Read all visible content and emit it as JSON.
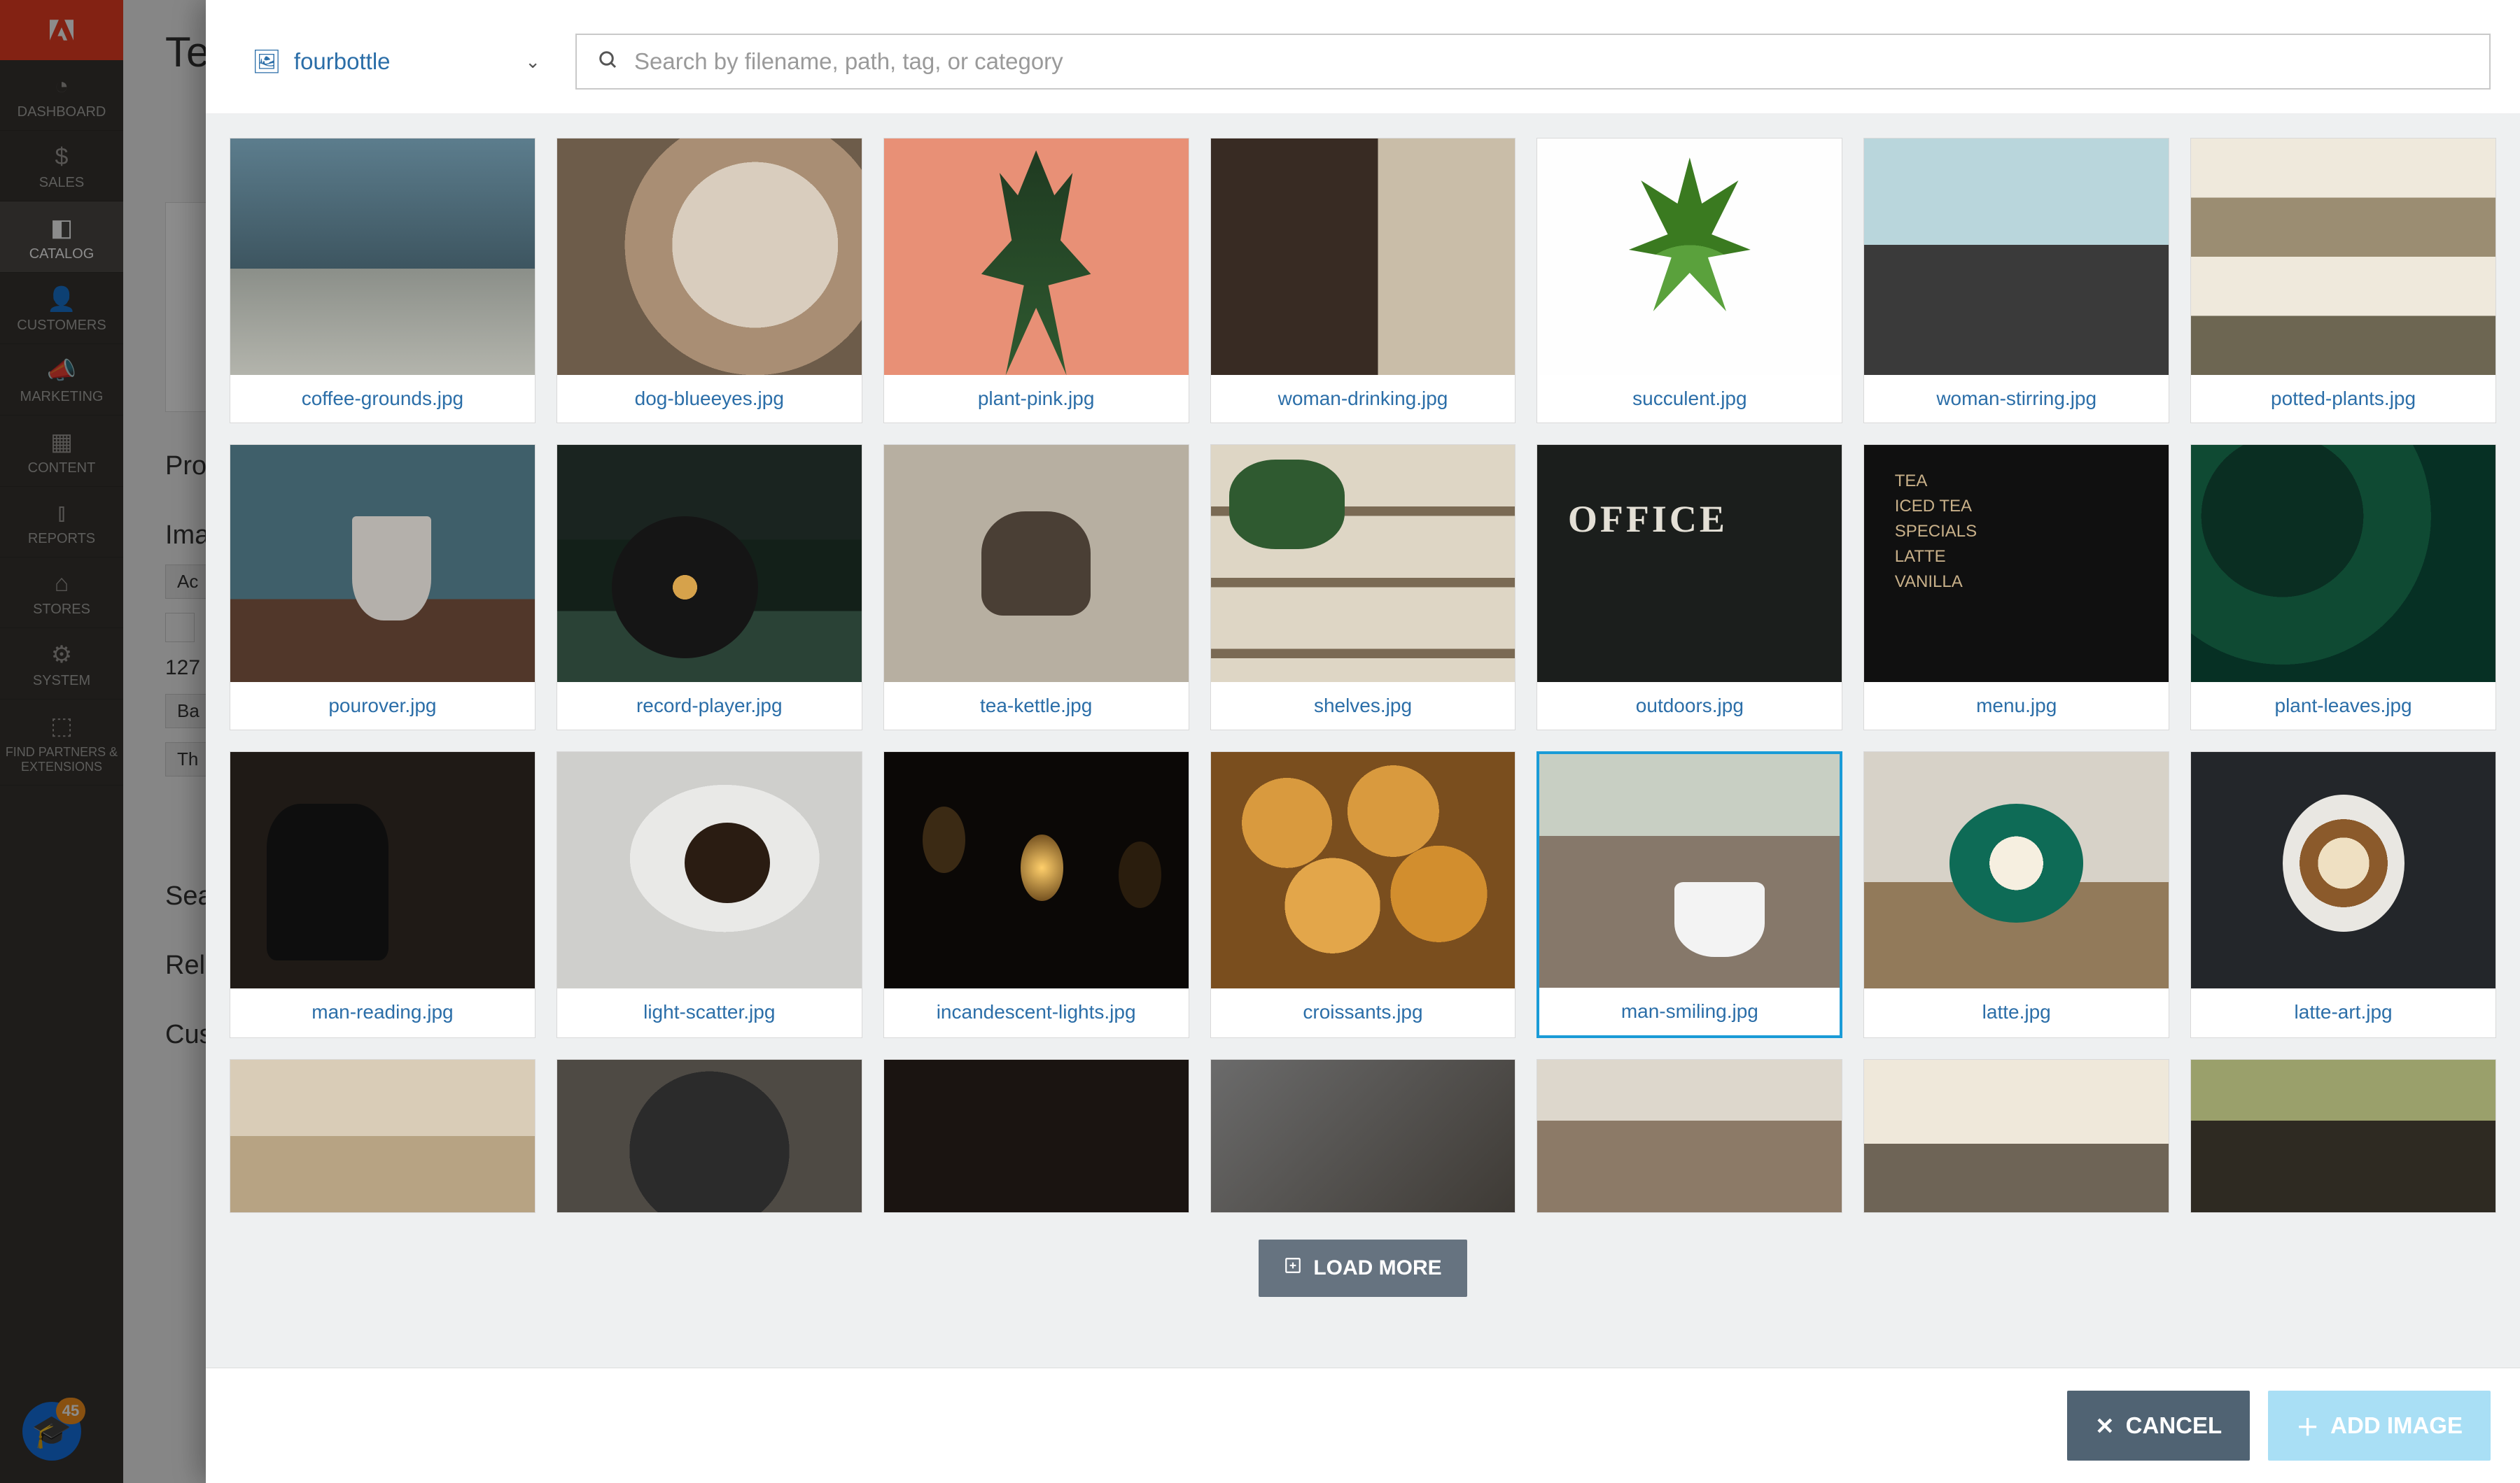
{
  "leftnav": {
    "items": [
      {
        "label": "DASHBOARD",
        "icon": "◔"
      },
      {
        "label": "SALES",
        "icon": "$"
      },
      {
        "label": "CATALOG",
        "icon": "◧",
        "active": true
      },
      {
        "label": "CUSTOMERS",
        "icon": "👤"
      },
      {
        "label": "MARKETING",
        "icon": "📣"
      },
      {
        "label": "CONTENT",
        "icon": "▦"
      },
      {
        "label": "REPORTS",
        "icon": "⫾"
      },
      {
        "label": "STORES",
        "icon": "⌂"
      },
      {
        "label": "SYSTEM",
        "icon": "⚙"
      },
      {
        "label": "FIND PARTNERS & EXTENSIONS",
        "icon": "⬚",
        "small": true
      }
    ]
  },
  "help_badge": "45",
  "page": {
    "title": "Teto",
    "section_product": "Pro",
    "section_images": "Ima",
    "section_actions": "Ac",
    "section_search": "Sea",
    "section_related": "Rela",
    "section_custom": "Cus",
    "count": "127",
    "chip_base": "Ba",
    "chip_thumb": "Th"
  },
  "modal": {
    "folder": "fourbottle",
    "search_placeholder": "Search by filename, path, tag, or category",
    "load_more": "LOAD MORE",
    "cancel": "CANCEL",
    "add_image": "ADD IMAGE",
    "selected": "man-smiling.jpg",
    "images": [
      {
        "file": "coffee-grounds.jpg",
        "cls": "g-a"
      },
      {
        "file": "dog-blueeyes.jpg",
        "cls": "g-b"
      },
      {
        "file": "plant-pink.jpg",
        "cls": "g-plantpink"
      },
      {
        "file": "woman-drinking.jpg",
        "cls": "g-womandrink"
      },
      {
        "file": "succulent.jpg",
        "cls": "g-succ"
      },
      {
        "file": "woman-stirring.jpg",
        "cls": "g-womanstir"
      },
      {
        "file": "potted-plants.jpg",
        "cls": "g-potted"
      },
      {
        "file": "pourover.jpg",
        "cls": "g-pour"
      },
      {
        "file": "record-player.jpg",
        "cls": "g-record"
      },
      {
        "file": "tea-kettle.jpg",
        "cls": "g-kettle"
      },
      {
        "file": "shelves.jpg",
        "cls": "g-shelves"
      },
      {
        "file": "outdoors.jpg",
        "cls": "g-out"
      },
      {
        "file": "menu.jpg",
        "cls": "g-menu"
      },
      {
        "file": "plant-leaves.jpg",
        "cls": "g-leaves"
      },
      {
        "file": "man-reading.jpg",
        "cls": "g-manread"
      },
      {
        "file": "light-scatter.jpg",
        "cls": "g-light"
      },
      {
        "file": "incandescent-lights.jpg",
        "cls": "g-incand"
      },
      {
        "file": "croissants.jpg",
        "cls": "g-crois"
      },
      {
        "file": "man-smiling.jpg",
        "cls": "g-mansmile"
      },
      {
        "file": "latte.jpg",
        "cls": "g-latte"
      },
      {
        "file": "latte-art.jpg",
        "cls": "g-latteart"
      }
    ],
    "partial": [
      {
        "cls": "g-p1"
      },
      {
        "cls": "g-p2"
      },
      {
        "cls": "g-p3"
      },
      {
        "cls": "g-p4"
      },
      {
        "cls": "g-p5"
      },
      {
        "cls": "g-p6"
      },
      {
        "cls": "g-p7"
      }
    ]
  }
}
